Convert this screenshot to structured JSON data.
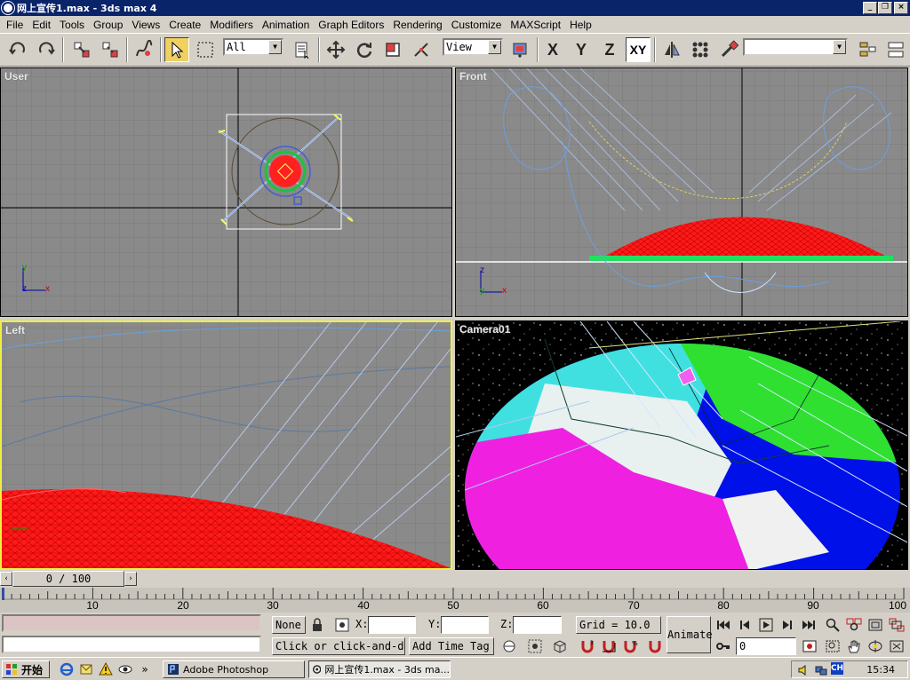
{
  "window": {
    "title": "网上宣传1.max - 3ds max 4",
    "controls": [
      "_",
      "❐",
      "×"
    ]
  },
  "menu": [
    "File",
    "Edit",
    "Tools",
    "Group",
    "Views",
    "Create",
    "Modifiers",
    "Animation",
    "Graph Editors",
    "Rendering",
    "Customize",
    "MAXScript",
    "Help"
  ],
  "toolbar": {
    "selection_filter": "All",
    "reference_coord": "View",
    "axis_x": "X",
    "axis_y": "Y",
    "axis_z": "Z",
    "axis_xy": "XY"
  },
  "viewports": {
    "top_left": "User",
    "top_right": "Front",
    "bottom_left": "Left",
    "bottom_right": "Camera01"
  },
  "time_slider": {
    "frame_display": "0 / 100",
    "current_frame": 0,
    "total_frames": 100,
    "tick_labels": [
      "10",
      "20",
      "30",
      "40",
      "50",
      "60",
      "70",
      "80",
      "90",
      "100"
    ]
  },
  "status": {
    "selection": "None",
    "x_label": "X:",
    "y_label": "Y:",
    "z_label": "Z:",
    "x_value": "",
    "y_value": "",
    "z_value": "",
    "grid": "Grid = 10.0",
    "prompt": "Click or click-and-drag",
    "add_time_tag": "Add Time Tag",
    "animate": "Animate",
    "frame_field": "0"
  },
  "colors": {
    "titlebar": "#0a246a",
    "viewport_bg": "#8a8a8a",
    "active_viewport_border": "#f0f040",
    "wire_red": "#ff0000",
    "animate_inactive": "#d4d0c8"
  },
  "taskbar": {
    "start": "开始",
    "tasks": [
      "Adobe Photoshop",
      "网上宣传1.max - 3ds ma..."
    ],
    "tray_lang": "CH",
    "clock": "15:34"
  }
}
